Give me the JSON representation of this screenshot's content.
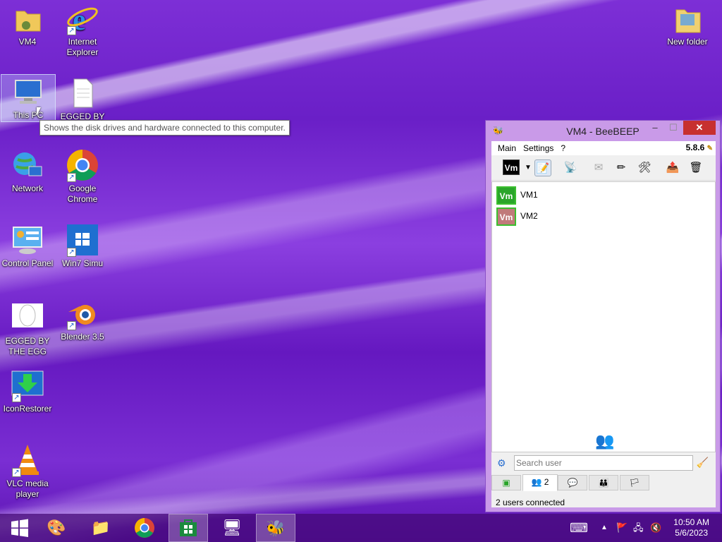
{
  "desktop": {
    "icons": [
      {
        "label": "VM4"
      },
      {
        "label": "Internet Explorer"
      },
      {
        "label": "This PC"
      },
      {
        "label": "EGGED BY"
      },
      {
        "label": "Network"
      },
      {
        "label": "Google Chrome"
      },
      {
        "label": "Control Panel"
      },
      {
        "label": "Win7 Simu"
      },
      {
        "label": "EGGED BY THE EGG"
      },
      {
        "label": "Blender 3.5"
      },
      {
        "label": "IconRestorer"
      },
      {
        "label": "VLC media player"
      },
      {
        "label": "New folder"
      }
    ],
    "tooltip": "Shows the disk drives and hardware connected to this computer."
  },
  "window": {
    "title": "VM4 - BeeBEEP",
    "menu": [
      "Main",
      "Settings",
      "?"
    ],
    "version": "5.8.6",
    "status_badge": "Vm",
    "users": [
      {
        "badge": "Vm",
        "name": "VM1",
        "color": "#2aa52a"
      },
      {
        "badge": "Vm",
        "name": "VM2",
        "color": "#c07a7a"
      }
    ],
    "search_placeholder": "Search user",
    "users_tab_count": "2",
    "status_text": "2 users connected",
    "close_symbol": "✕",
    "minimize_symbol": "–",
    "maximize_symbol": "☐"
  },
  "taskbar": {
    "clock_time": "10:50 AM",
    "clock_date": "5/6/2023"
  }
}
